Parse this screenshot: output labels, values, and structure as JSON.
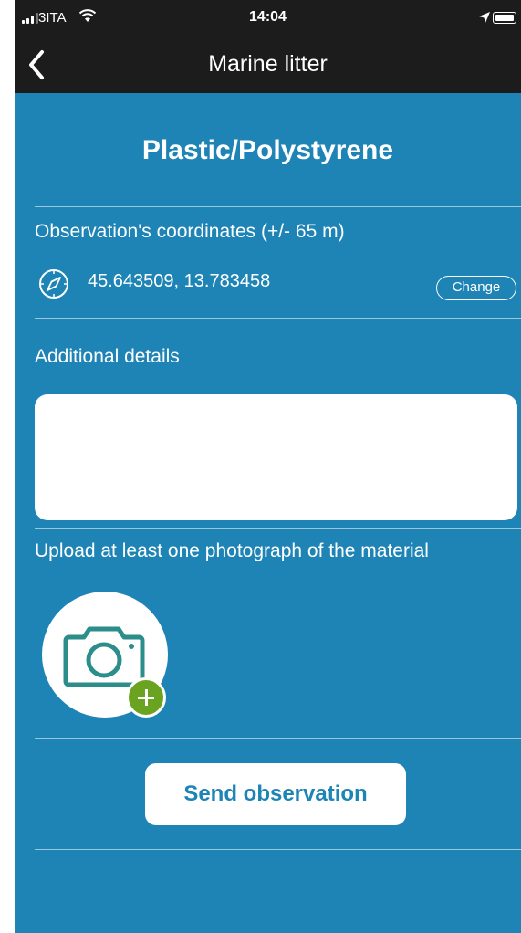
{
  "status_bar": {
    "carrier": "3ITA",
    "time": "14:04"
  },
  "nav": {
    "title": "Marine litter",
    "back_icon": "chevron-left-icon"
  },
  "content": {
    "category_title": "Plastic/Polystyrene",
    "coords_label": "Observation's coordinates (+/- 65 m)",
    "coords_value": "45.643509, 13.783458",
    "change_label": "Change",
    "details_label": "Additional details",
    "details_value": "",
    "upload_label": "Upload at least one photograph of the material",
    "send_label": "Send observation"
  },
  "colors": {
    "background": "#1d84b5",
    "header": "#1c1c1c",
    "camera_icon": "#2c8e8a",
    "plus_badge": "#6aa31f"
  }
}
